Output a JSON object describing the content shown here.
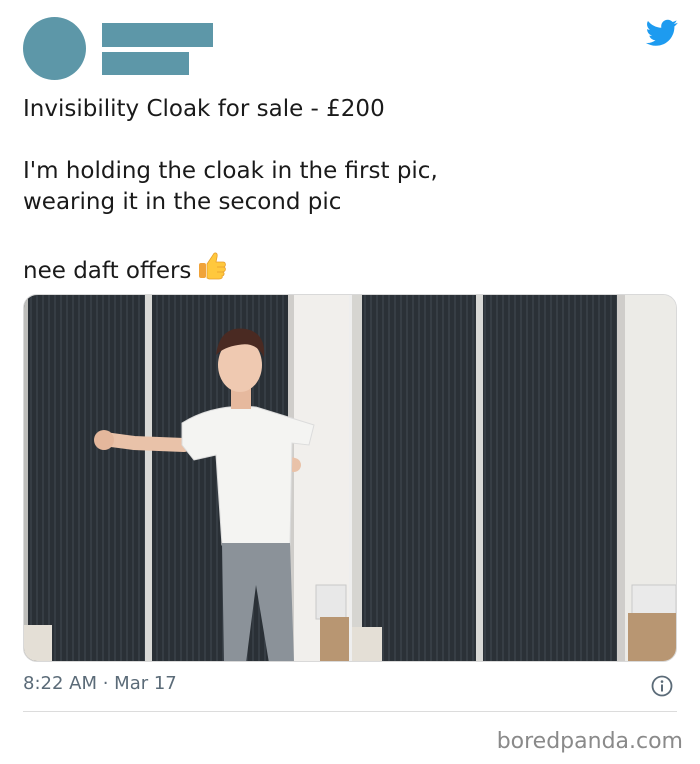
{
  "tweet": {
    "line1": "Invisibility Cloak for sale - £200",
    "line2": "I'm holding the cloak in the first pic,",
    "line3": "wearing it in the second pic",
    "line4": "nee daft offers",
    "time": "8:22 AM",
    "separator": " · ",
    "date": "Mar 17"
  },
  "icons": {
    "brand": "twitter-bird-icon",
    "emoji": "thumbs-up-icon",
    "info": "info-icon"
  },
  "colors": {
    "redaction": "#5d97a8",
    "twitter_blue": "#1d9bf0",
    "meta_text": "#5b6b78"
  },
  "watermark": "boredpanda.com"
}
